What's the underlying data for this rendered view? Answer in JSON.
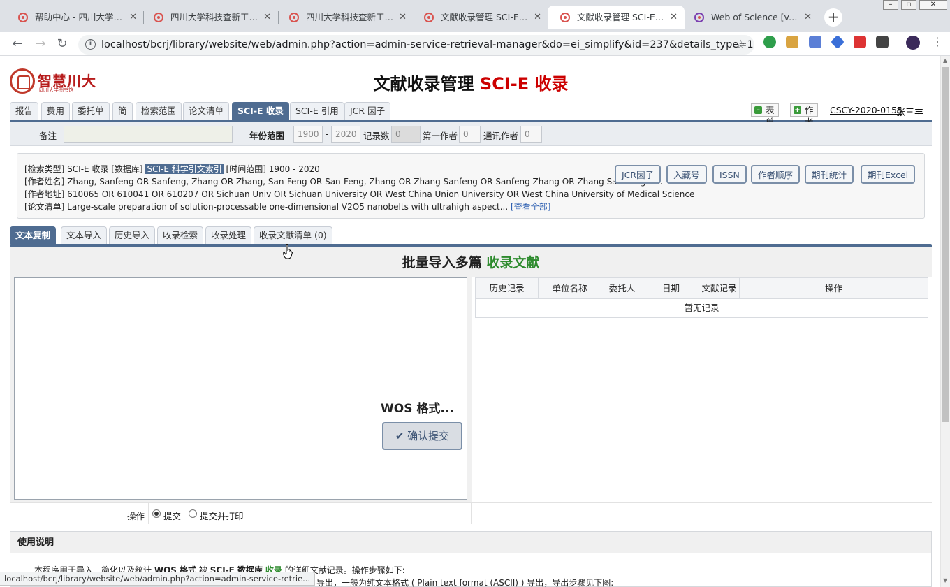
{
  "browser": {
    "tabs": [
      {
        "title": "帮助中心 - 四川大学科技"
      },
      {
        "title": "四川大学科技查新工作站"
      },
      {
        "title": "四川大学科技查新工作站"
      },
      {
        "title": "文献收录管理 SCI-E 收录"
      },
      {
        "title": "文献收录管理 SCI-E 收录"
      },
      {
        "title": "Web of Science [v.5.35]"
      }
    ],
    "active_tab": 4,
    "url": "localhost/bcrj/library/website/web/admin.php?action=admin-service-retrieval-manager&do=ei_simplify&id=237&details_type=1",
    "status_url": "localhost/bcrj/library/website/web/admin.php?action=admin-service-retrie..."
  },
  "header": {
    "logo_text": "智慧川大",
    "logo_sub": "四川大学图书馆",
    "title_main": "文献收录管理",
    "title_accent": "SCI-E 收录"
  },
  "main_tabs": [
    "报告",
    "费用",
    "委托单",
    "简",
    "检索范围",
    "论文清单",
    "SCI-E 收录",
    "SCI-E 引用",
    "JCR 因子"
  ],
  "main_tab_active": 6,
  "right": {
    "form_button": "表单",
    "author_button": "作者",
    "code": "CSCY-2020-0155",
    "user": "张三丰"
  },
  "filter": {
    "note_label": "备注",
    "year_label": "年份范围",
    "year_from": "1900",
    "year_sep": "-",
    "year_to": "2020",
    "count_label": "记录数",
    "count_value": "0",
    "first_author_label": "第一作者",
    "first_author_value": "0",
    "corr_author_label": "通讯作者",
    "corr_author_value": "0"
  },
  "info": {
    "line1_a": "[检索类型] SCI-E 收录 [数据库]",
    "line1_hl": "SCI-E 科学引文索引",
    "line1_b": "[时间范围] 1900 - 2020",
    "line2": "[作者姓名] Zhang, Sanfeng OR Sanfeng, Zhang OR Zhang, San-Feng OR San-Feng, Zhang OR Zhang Sanfeng OR Sanfeng Zhang OR Zhang San-Feng O...",
    "line3": "[作者地址] 610065 OR 610041 OR 610207 OR Sichuan Univ OR Sichuan University OR West China Union University OR West China University of Medical Science",
    "line4": "[论文清单] Large-scale preparation of solution-processable one-dimensional V2O5 nanobelts with ultrahigh aspect...",
    "view_all": "[查看全部]",
    "buttons": [
      "JCR因子",
      "入藏号",
      "ISSN",
      "作者顺序",
      "期刊统计",
      "期刊Excel"
    ]
  },
  "sub_tabs": [
    "文本复制",
    "文本导入",
    "历史导入",
    "收录检索",
    "收录处理",
    "收录文献清单 (0)"
  ],
  "sub_tab_active": 0,
  "panel": {
    "title_a": "批量导入多篇",
    "title_b": "收录文献",
    "format_hint": "WOS 格式...",
    "submit": "✔ 确认提交",
    "table_headers": [
      "历史记录",
      "单位名称",
      "委托人",
      "日期",
      "文献记录",
      "操作"
    ],
    "empty_text": "暂无记录",
    "op_label": "操作",
    "op_options": [
      "提交",
      "提交并打印"
    ],
    "op_selected": 0
  },
  "usage": {
    "title": "使用说明",
    "line1_a": "本程序用于导入、简化以及统计",
    "line1_b": "WOS 格式",
    "line1_c": "被",
    "line1_d": "SCI-E 数据库",
    "line1_e": "收录",
    "line1_f": "的详细文献记录。操作步骤如下:",
    "line2": "导出，一般为纯文本格式 ( Plain text format (ASCII) ) 导出，导出步骤见下图:"
  }
}
